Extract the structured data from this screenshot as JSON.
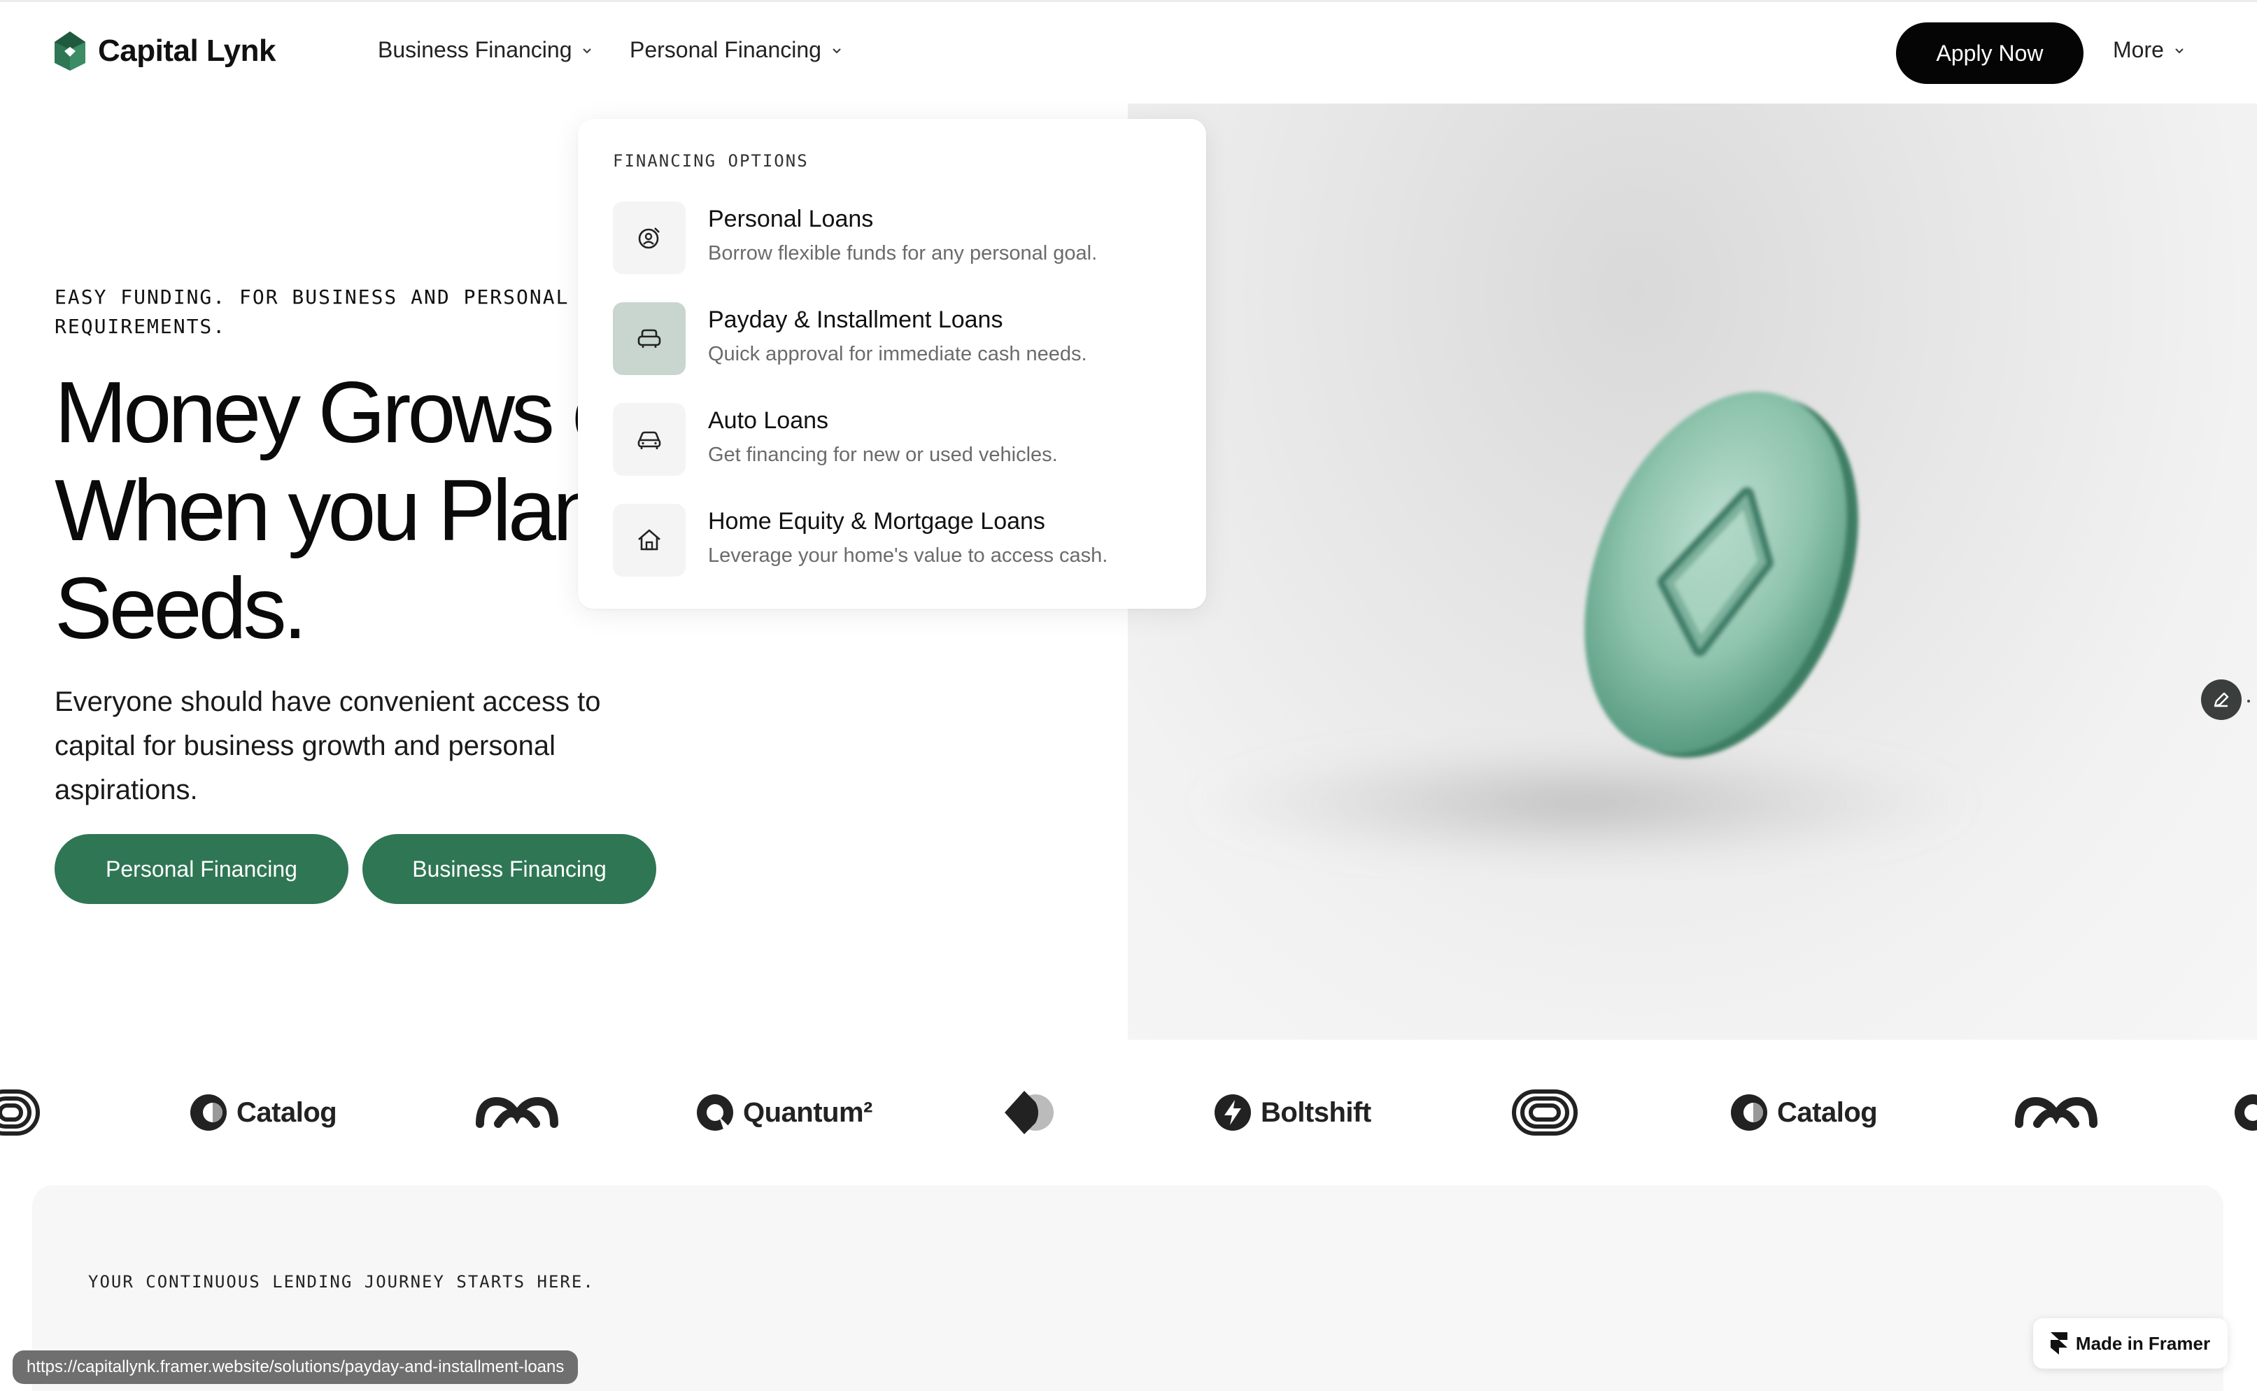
{
  "brand": {
    "name": "Capital Lynk",
    "accent": "#2f7654"
  },
  "nav": {
    "items": [
      {
        "label": "Business Financing"
      },
      {
        "label": "Personal Financing"
      }
    ],
    "apply_label": "Apply Now",
    "more_label": "More"
  },
  "hero": {
    "eyebrow": "EASY FUNDING. FOR BUSINESS AND PERSONAL\nREQUIREMENTS.",
    "title_lines": [
      "Money Grows on",
      "When you Plant",
      "Seeds."
    ],
    "description": "Everyone should have convenient access to capital for business growth and personal aspirations.",
    "cta_personal": "Personal Financing",
    "cta_business": "Business Financing"
  },
  "dropdown": {
    "heading": "FINANCING OPTIONS",
    "items": [
      {
        "title": "Personal Loans",
        "subtitle": "Borrow flexible funds for any personal goal.",
        "icon": "target-user-icon"
      },
      {
        "title": "Payday & Installment Loans",
        "subtitle": "Quick approval for immediate cash needs.",
        "icon": "armchair-icon",
        "hovered": true
      },
      {
        "title": "Auto Loans",
        "subtitle": "Get financing for new or used vehicles.",
        "icon": "car-icon"
      },
      {
        "title": "Home Equity & Mortgage Loans",
        "subtitle": "Leverage your home's value to access cash.",
        "icon": "home-icon"
      }
    ]
  },
  "partners": [
    "Catalog",
    "Quantum²",
    "Boltshift",
    "Catalog"
  ],
  "journey": {
    "eyebrow": "YOUR CONTINUOUS LENDING JOURNEY STARTS HERE."
  },
  "framer_badge": "Made in Framer",
  "status_url": "https://capitallynk.framer.website/solutions/payday-and-installment-loans"
}
